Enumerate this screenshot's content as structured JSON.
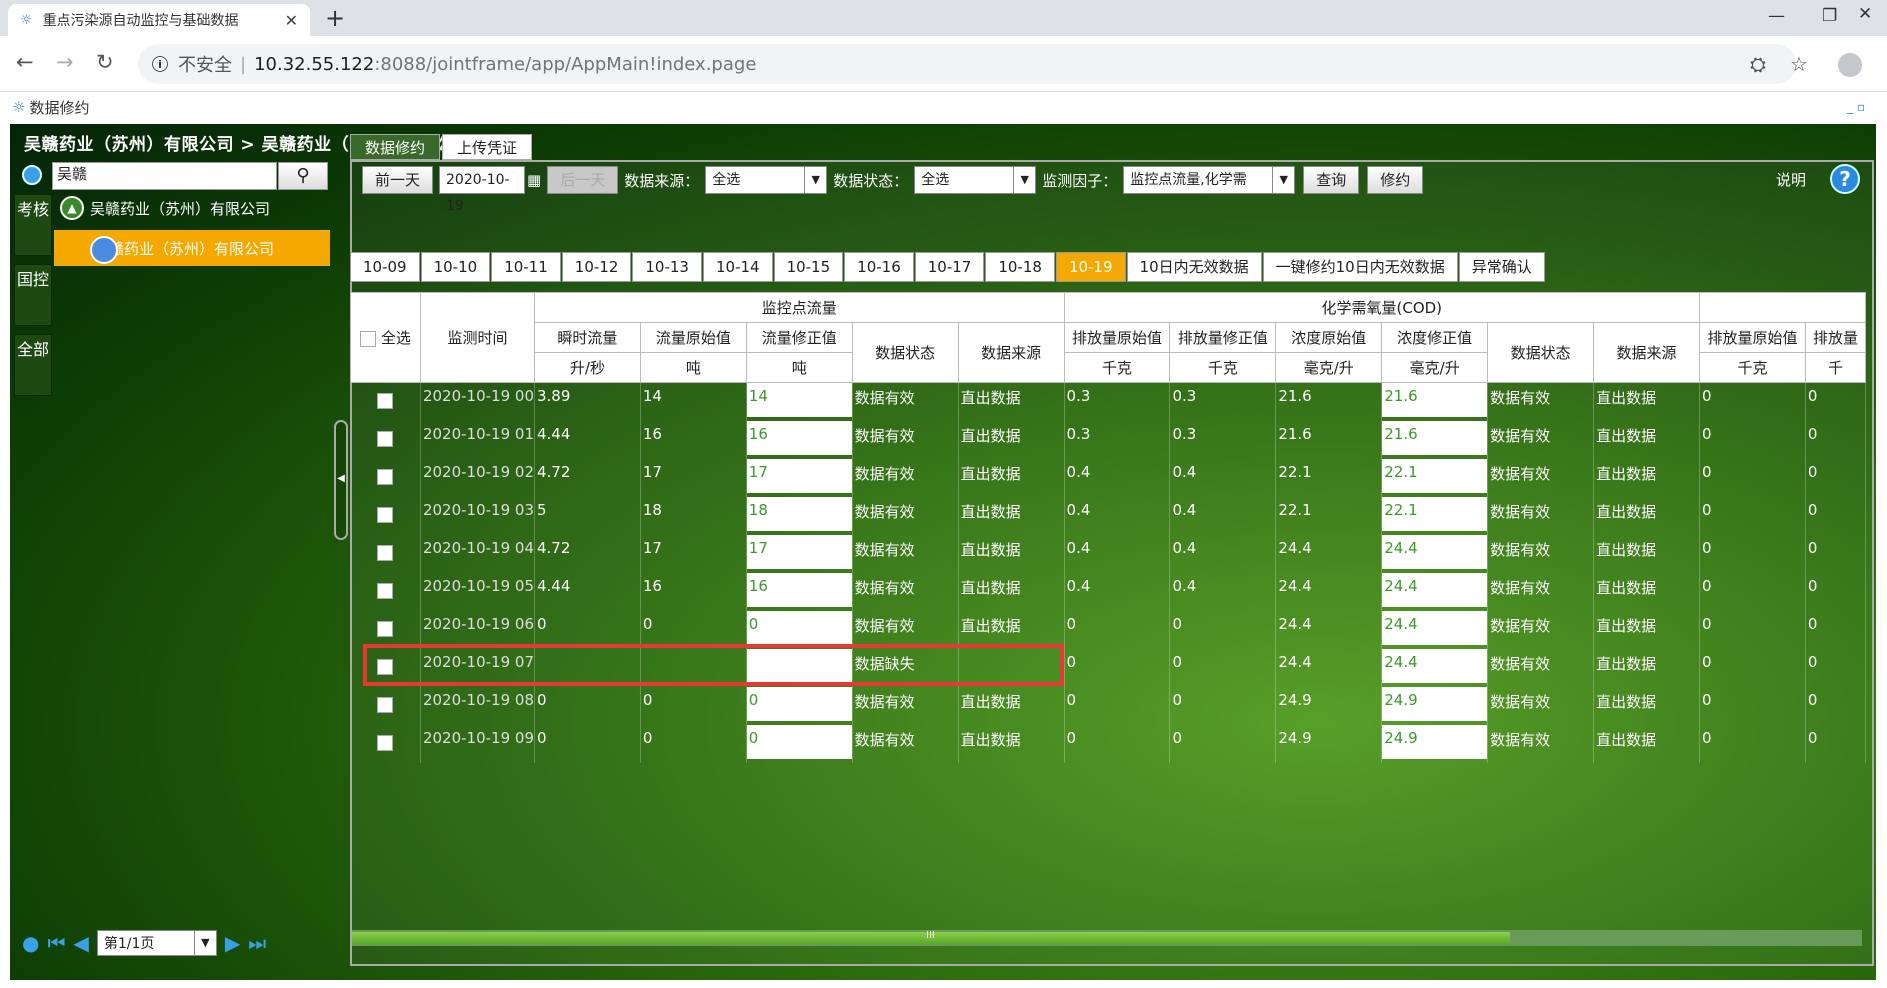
{
  "browser": {
    "tab_title": "重点污染源自动监控与基础数据",
    "security_label": "不安全",
    "url_host": "10.32.55.122",
    "url_path": ":8088/jointframe/app/AppMain!index.page"
  },
  "app": {
    "title": "数据修约",
    "breadcrumb": "吴赣药业（苏州）有限公司 > 吴赣药业（苏州）有限公司",
    "search_value": "吴赣",
    "vtabs": [
      "考核",
      "国控",
      "全部"
    ],
    "tree": {
      "root": "吴赣药业（苏州）有限公司",
      "selected": "吴赣药业（苏州）有限公司"
    },
    "pager": "第1/1页"
  },
  "toptabs": [
    "数据修约",
    "上传凭证"
  ],
  "toolbar": {
    "prev_day": "前一天",
    "date": "2020-10-19",
    "next_day": "后一天",
    "source_label": "数据来源：",
    "source_value": "全选",
    "status_label": "数据状态：",
    "status_value": "全选",
    "factor_label": "监测因子：",
    "factor_value": "监控点流量,化学需",
    "query": "查询",
    "revise": "修约",
    "help": "说明"
  },
  "datetabs": [
    "10-09",
    "10-10",
    "10-11",
    "10-12",
    "10-13",
    "10-14",
    "10-15",
    "10-16",
    "10-17",
    "10-18",
    "10-19",
    "10日内无效数据",
    "一键修约10日内无效数据",
    "异常确认"
  ],
  "table": {
    "select_all": "全选",
    "time_header": "监测时间",
    "group1": "监控点流量",
    "group2": "化学需氧量(COD)",
    "sub": [
      "瞬时流量",
      "流量原始值",
      "流量修正值",
      "数据状态",
      "数据来源",
      "排放量原始值",
      "排放量修正值",
      "浓度原始值",
      "浓度修正值",
      "数据状态",
      "数据来源",
      "排放量原始值",
      "排放量"
    ],
    "units": [
      "升/秒",
      "吨",
      "吨",
      "千克",
      "千克",
      "毫克/升",
      "毫克/升",
      "千克",
      "千"
    ],
    "rows": [
      [
        "2020-10-19 00",
        "3.89",
        "14",
        "14",
        "数据有效",
        "直出数据",
        "0.3",
        "0.3",
        "21.6",
        "21.6",
        "数据有效",
        "直出数据",
        "0",
        "0"
      ],
      [
        "2020-10-19 01",
        "4.44",
        "16",
        "16",
        "数据有效",
        "直出数据",
        "0.3",
        "0.3",
        "21.6",
        "21.6",
        "数据有效",
        "直出数据",
        "0",
        "0"
      ],
      [
        "2020-10-19 02",
        "4.72",
        "17",
        "17",
        "数据有效",
        "直出数据",
        "0.4",
        "0.4",
        "22.1",
        "22.1",
        "数据有效",
        "直出数据",
        "0",
        "0"
      ],
      [
        "2020-10-19 03",
        "5",
        "18",
        "18",
        "数据有效",
        "直出数据",
        "0.4",
        "0.4",
        "22.1",
        "22.1",
        "数据有效",
        "直出数据",
        "0",
        "0"
      ],
      [
        "2020-10-19 04",
        "4.72",
        "17",
        "17",
        "数据有效",
        "直出数据",
        "0.4",
        "0.4",
        "24.4",
        "24.4",
        "数据有效",
        "直出数据",
        "0",
        "0"
      ],
      [
        "2020-10-19 05",
        "4.44",
        "16",
        "16",
        "数据有效",
        "直出数据",
        "0.4",
        "0.4",
        "24.4",
        "24.4",
        "数据有效",
        "直出数据",
        "0",
        "0"
      ],
      [
        "2020-10-19 06",
        "0",
        "0",
        "0",
        "数据有效",
        "直出数据",
        "0",
        "0",
        "24.4",
        "24.4",
        "数据有效",
        "直出数据",
        "0",
        "0"
      ],
      [
        "2020-10-19 07",
        "",
        "",
        "",
        "数据缺失",
        "",
        "0",
        "0",
        "24.4",
        "24.4",
        "数据有效",
        "直出数据",
        "0",
        "0"
      ],
      [
        "2020-10-19 08",
        "0",
        "0",
        "0",
        "数据有效",
        "直出数据",
        "0",
        "0",
        "24.9",
        "24.9",
        "数据有效",
        "直出数据",
        "0",
        "0"
      ],
      [
        "2020-10-19 09",
        "0",
        "0",
        "0",
        "数据有效",
        "直出数据",
        "0",
        "0",
        "24.9",
        "24.9",
        "数据有效",
        "直出数据",
        "0",
        "0"
      ]
    ]
  }
}
